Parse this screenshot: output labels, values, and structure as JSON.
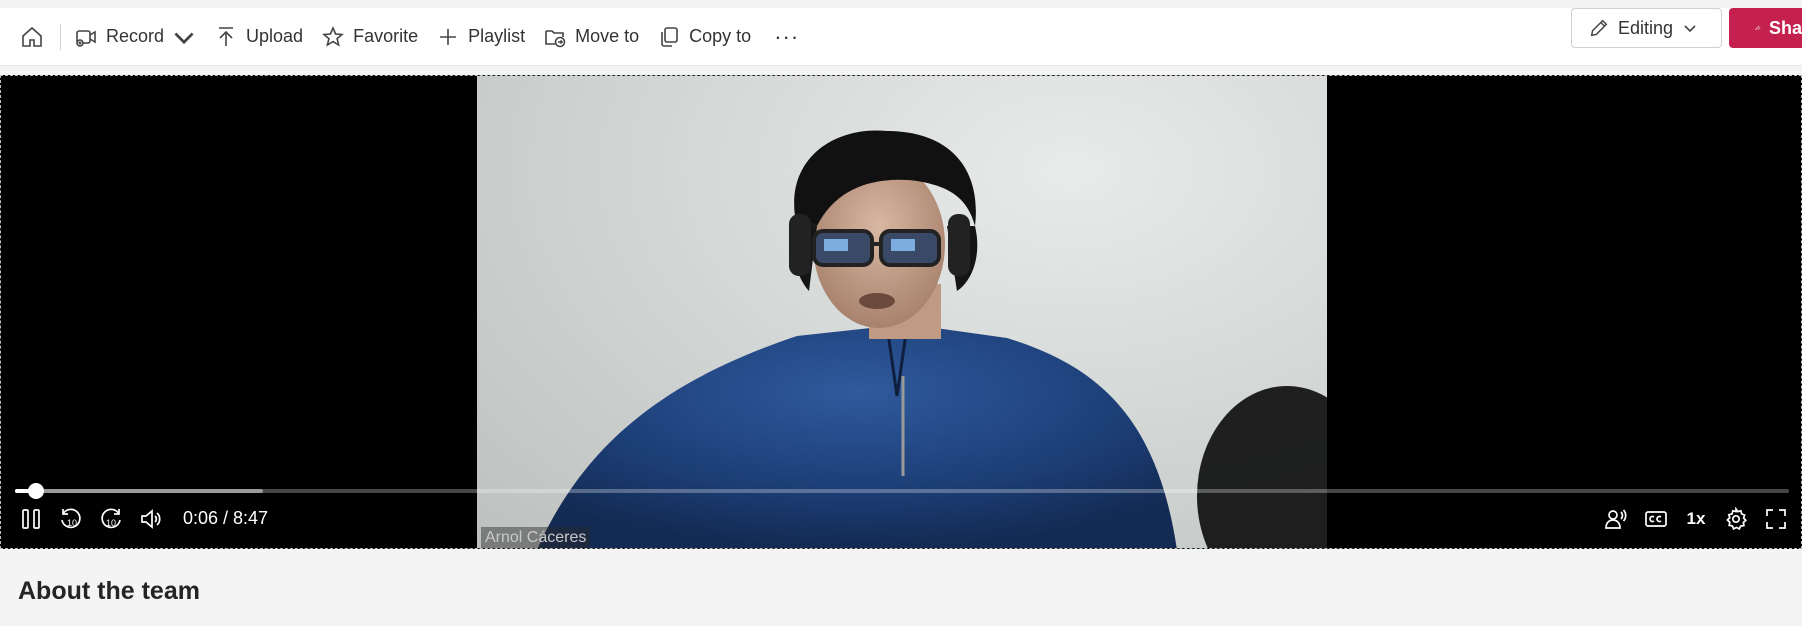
{
  "toolbar": {
    "home_label": "Home",
    "record_label": "Record",
    "upload_label": "Upload",
    "favorite_label": "Favorite",
    "playlist_label": "Playlist",
    "move_to_label": "Move to",
    "copy_to_label": "Copy to",
    "more_label": "···",
    "editing_label": "Editing",
    "share_label": "Share"
  },
  "player": {
    "current_time": "0:06",
    "duration": "8:47",
    "time_display": "0:06 / 8:47",
    "played_fraction": 0.0118,
    "buffered_fraction": 0.14,
    "speaker_name": "Arnol Cáceres",
    "speed_label": "1x",
    "skip_back_seconds": "10",
    "skip_forward_seconds": "10"
  },
  "section": {
    "title": "About the team"
  },
  "colors": {
    "share_accent": "#c4214f",
    "player_background": "#000000"
  },
  "icons": [
    "home-icon",
    "record-icon",
    "upload-icon",
    "star-icon",
    "plus-icon",
    "move-folder-icon",
    "copy-icon",
    "more-icon",
    "pencil-icon",
    "share-icon",
    "pause-icon",
    "rewind-10-icon",
    "forward-10-icon",
    "volume-icon",
    "speaker-coach-icon",
    "captions-icon",
    "settings-gear-icon",
    "fullscreen-icon"
  ]
}
